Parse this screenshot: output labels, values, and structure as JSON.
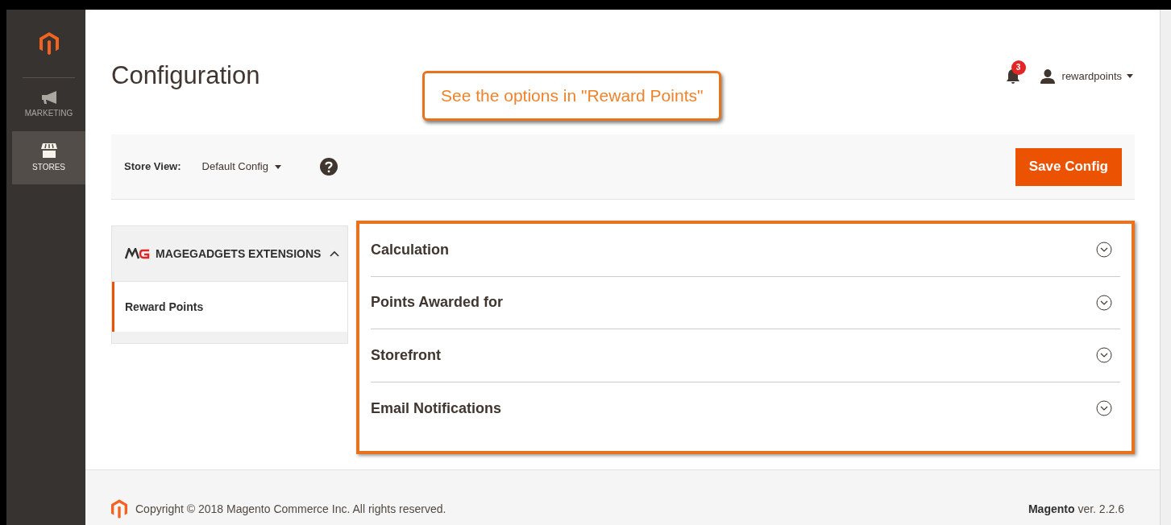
{
  "sidebar": {
    "items": [
      {
        "label": "MARKETING",
        "kind": "megaphone",
        "selected": false
      },
      {
        "label": "STORES",
        "kind": "store",
        "selected": true
      }
    ]
  },
  "page_title": "Configuration",
  "callout": "See the options in \"Reward Points\"",
  "notifications": {
    "count": "3"
  },
  "user": {
    "name": "rewardpoints"
  },
  "store_view": {
    "label": "Store View:",
    "value": "Default Config"
  },
  "save_button": "Save Config",
  "config_nav": {
    "group": "MAGEGADGETS EXTENSIONS",
    "expanded": true,
    "items": [
      {
        "label": "Reward Points",
        "selected": true
      }
    ]
  },
  "sections": [
    {
      "title": "Calculation",
      "expanded": false
    },
    {
      "title": "Points Awarded for",
      "expanded": false
    },
    {
      "title": "Storefront",
      "expanded": false
    },
    {
      "title": "Email Notifications",
      "expanded": false
    }
  ],
  "footer": {
    "copyright": "Copyright © 2018 Magento Commerce Inc. All rights reserved.",
    "version": "**Magento** ver. 2.2.6"
  }
}
